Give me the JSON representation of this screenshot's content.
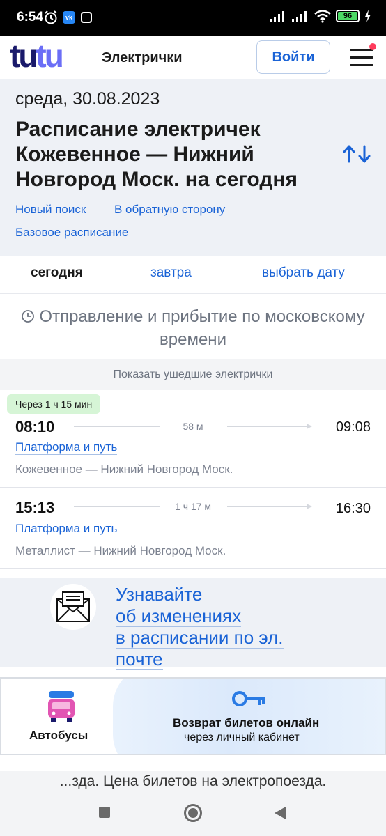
{
  "status_bar": {
    "time": "6:54",
    "battery": "96",
    "icons": [
      "alarm-icon",
      "vk-icon",
      "app-icon",
      "signal-icon",
      "signal-icon",
      "wifi-icon",
      "battery-icon",
      "charging-icon"
    ]
  },
  "header": {
    "logo_part1": "tu",
    "logo_part2": "tu",
    "service": "Электрички",
    "login_label": "Войти",
    "logo_colors": {
      "dark": "#1a1a6b",
      "light": "#6b6ef6"
    }
  },
  "search": {
    "date": "среда, 30.08.2023",
    "title": "Расписание электричек Кожевенное — Нижний Новгород Моск. на сегодня",
    "links": {
      "new_search": "Новый поиск",
      "reverse": "В обратную сторону",
      "base_schedule": "Базовое расписание"
    }
  },
  "day_tabs": {
    "today": "сегодня",
    "tomorrow": "завтра",
    "pick_date": "выбрать дату"
  },
  "timezone_note": "Отправление и прибытие по московскому времени",
  "show_departed": "Показать ушедшие электрички",
  "trains": [
    {
      "badge": "Через 1 ч 15 мин",
      "departure": "08:10",
      "duration": "58 м",
      "arrival": "09:08",
      "platform": "Платформа и путь",
      "route": "Кожевенное — Нижний Новгород Моск."
    },
    {
      "departure": "15:13",
      "duration": "1 ч 17 м",
      "arrival": "16:30",
      "platform": "Платформа и путь",
      "route": "Металлист — Нижний Новгород Моск."
    }
  ],
  "subscribe": {
    "lines": [
      "Узнавайте",
      "об изменениях",
      "в расписании по эл.",
      "почте"
    ]
  },
  "banner": {
    "bus_label": "Автобусы",
    "return_title": "Возврат билетов онлайн",
    "return_sub": "через личный кабинет"
  },
  "bottom_text": "...зда. Цена билетов на электропоезда.",
  "colors": {
    "accent": "#1a63d6",
    "badge_green": "#d6f5d6",
    "block_bg": "#eef1f6"
  }
}
